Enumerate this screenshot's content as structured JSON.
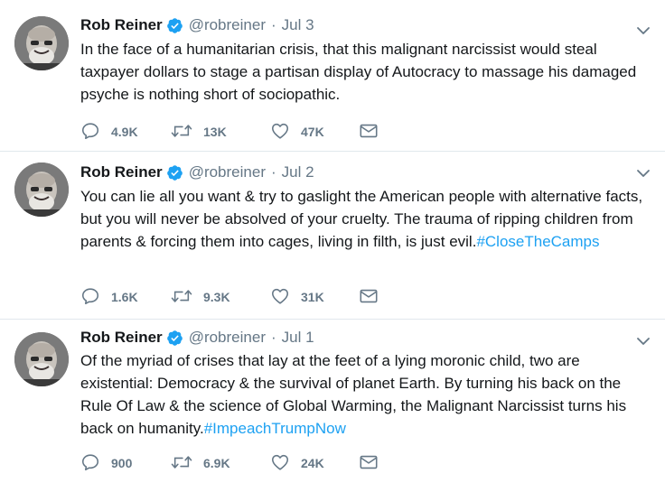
{
  "tweets": [
    {
      "name": "Rob Reiner",
      "handle": "@robreiner",
      "separator": "·",
      "time": "Jul 3",
      "text": "In the face of a humanitarian crisis, that this malignant narcissist would steal taxpayer dollars to stage a partisan display of Autocracy to massage his damaged psyche is nothing short of sociopathic.",
      "hashtag": "",
      "replies": "4.9K",
      "retweets": "13K",
      "likes": "47K"
    },
    {
      "name": "Rob Reiner",
      "handle": "@robreiner",
      "separator": "·",
      "time": "Jul 2",
      "text": "You can lie all you want & try to gaslight the American people with alternative facts, but you will never be absolved of your cruelty. The trauma of ripping children from parents & forcing them into cages, living in filth, is just evil.",
      "hashtag": "#CloseTheCamps",
      "replies": "1.6K",
      "retweets": "9.3K",
      "likes": "31K"
    },
    {
      "name": "Rob Reiner",
      "handle": "@robreiner",
      "separator": "·",
      "time": "Jul 1",
      "text": "Of the myriad of crises that lay at the feet of a lying moronic child, two are existential: Democracy & the survival of planet Earth. By turning his back on the Rule Of Law & the science of Global Warming, the Malignant Narcissist turns his back on humanity.",
      "hashtag": "#ImpeachTrumpNow",
      "replies": "900",
      "retweets": "6.9K",
      "likes": "24K"
    }
  ],
  "colors": {
    "text": "#14171a",
    "secondary": "#657786",
    "link": "#1da1f2",
    "verified": "#1da1f2",
    "divider": "#e1e8ed"
  },
  "icons": {
    "reply": "reply-icon",
    "retweet": "retweet-icon",
    "like": "heart-icon",
    "dm": "envelope-icon",
    "verified": "verified-badge-icon",
    "more": "chevron-down-icon"
  }
}
